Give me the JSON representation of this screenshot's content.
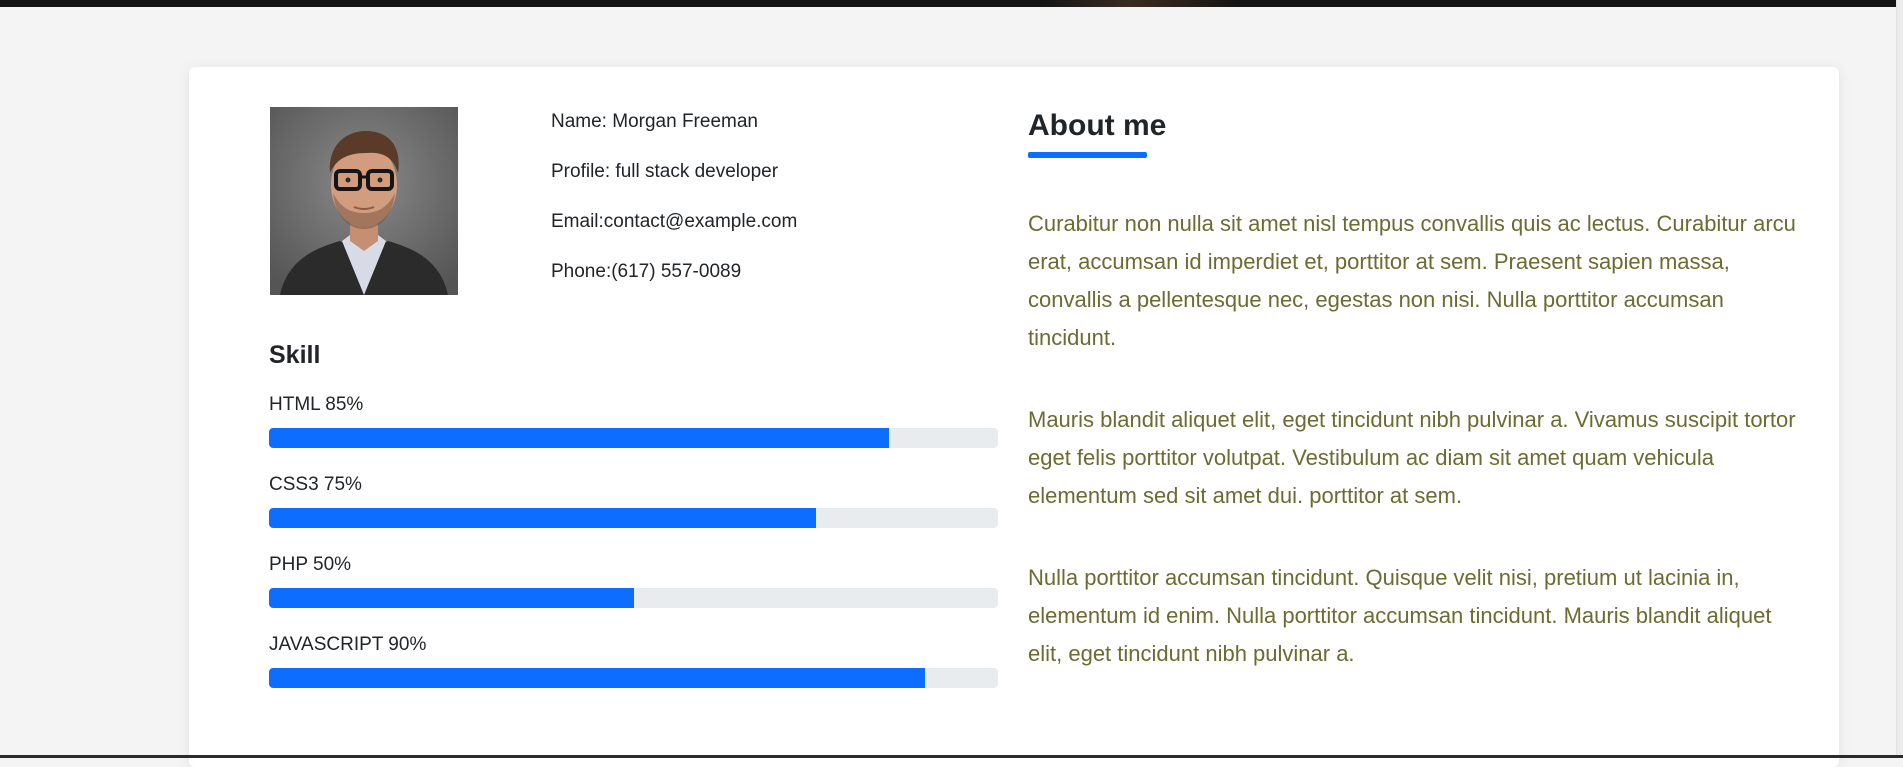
{
  "profile": {
    "name": "Name: Morgan Freeman",
    "role": "Profile: full stack developer",
    "email": "Email:contact@example.com",
    "phone": "Phone:(617) 557-0089"
  },
  "skills": {
    "title": "Skill",
    "items": [
      {
        "label": "HTML 85%",
        "percent": 85
      },
      {
        "label": "CSS3 75%",
        "percent": 75
      },
      {
        "label": "PHP 50%",
        "percent": 50
      },
      {
        "label": "JAVASCRIPT 90%",
        "percent": 90
      }
    ]
  },
  "about": {
    "title": "About me",
    "paragraphs": [
      "Curabitur non nulla sit amet nisl tempus convallis quis ac lectus. Curabitur arcu erat, accumsan id imperdiet et, porttitor at sem. Praesent sapien massa, convallis a pellentesque nec, egestas non nisi. Nulla porttitor accumsan tincidunt.",
      "Mauris blandit aliquet elit, eget tincidunt nibh pulvinar a. Vivamus suscipit tortor eget felis porttitor volutpat. Vestibulum ac diam sit amet quam vehicula elementum sed sit amet dui. porttitor at sem.",
      "Nulla porttitor accumsan tincidunt. Quisque velit nisi, pretium ut lacinia in, elementum id enim. Nulla porttitor accumsan tincidunt. Mauris blandit aliquet elit, eget tincidunt nibh pulvinar a."
    ]
  },
  "colors": {
    "accent": "#0d6efd",
    "track": "#e9ecef",
    "paragraph": "#6b6b32",
    "page_bg": "#f4f4f4"
  }
}
